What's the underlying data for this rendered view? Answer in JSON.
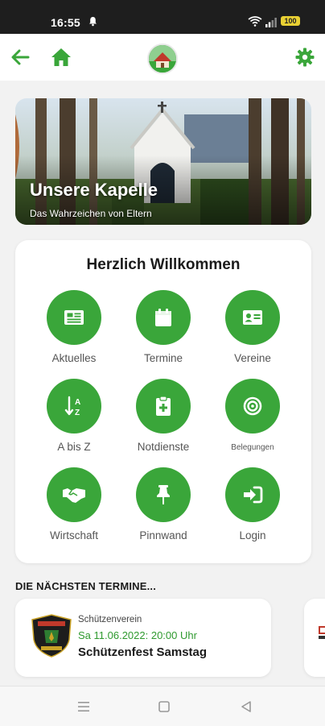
{
  "status_bar": {
    "time": "16:55",
    "battery": "100"
  },
  "app_bar": {
    "back_icon": "arrow-left-icon",
    "home_icon": "home-icon",
    "logo_icon": "town-logo",
    "settings_icon": "gear-icon"
  },
  "hero": {
    "title": "Unsere Kapelle",
    "subtitle": "Das Wahrzeichen von Eltern"
  },
  "welcome": {
    "title": "Herzlich Willkommen",
    "tiles": [
      {
        "label": "Aktuelles",
        "icon": "newspaper-icon"
      },
      {
        "label": "Termine",
        "icon": "calendar-icon"
      },
      {
        "label": "Vereine",
        "icon": "id-card-icon"
      },
      {
        "label": "A bis Z",
        "icon": "sort-alpha-icon"
      },
      {
        "label": "Notdienste",
        "icon": "medical-clipboard-icon"
      },
      {
        "label": "Belegungen",
        "icon": "target-icon"
      },
      {
        "label": "Wirtschaft",
        "icon": "handshake-icon"
      },
      {
        "label": "Pinnwand",
        "icon": "pushpin-icon"
      },
      {
        "label": "Login",
        "icon": "sign-in-icon"
      }
    ]
  },
  "events": {
    "heading": "DIE NÄCHSTEN TERMINE...",
    "items": [
      {
        "club": "Schützenverein",
        "date": "Sa 11.06.2022: 20:00 Uhr",
        "title": "Schützenfest Samstag"
      }
    ]
  },
  "colors": {
    "accent": "#3aa63a",
    "accent_dark": "#2f9a2f",
    "date_text": "#2f9a2f"
  }
}
